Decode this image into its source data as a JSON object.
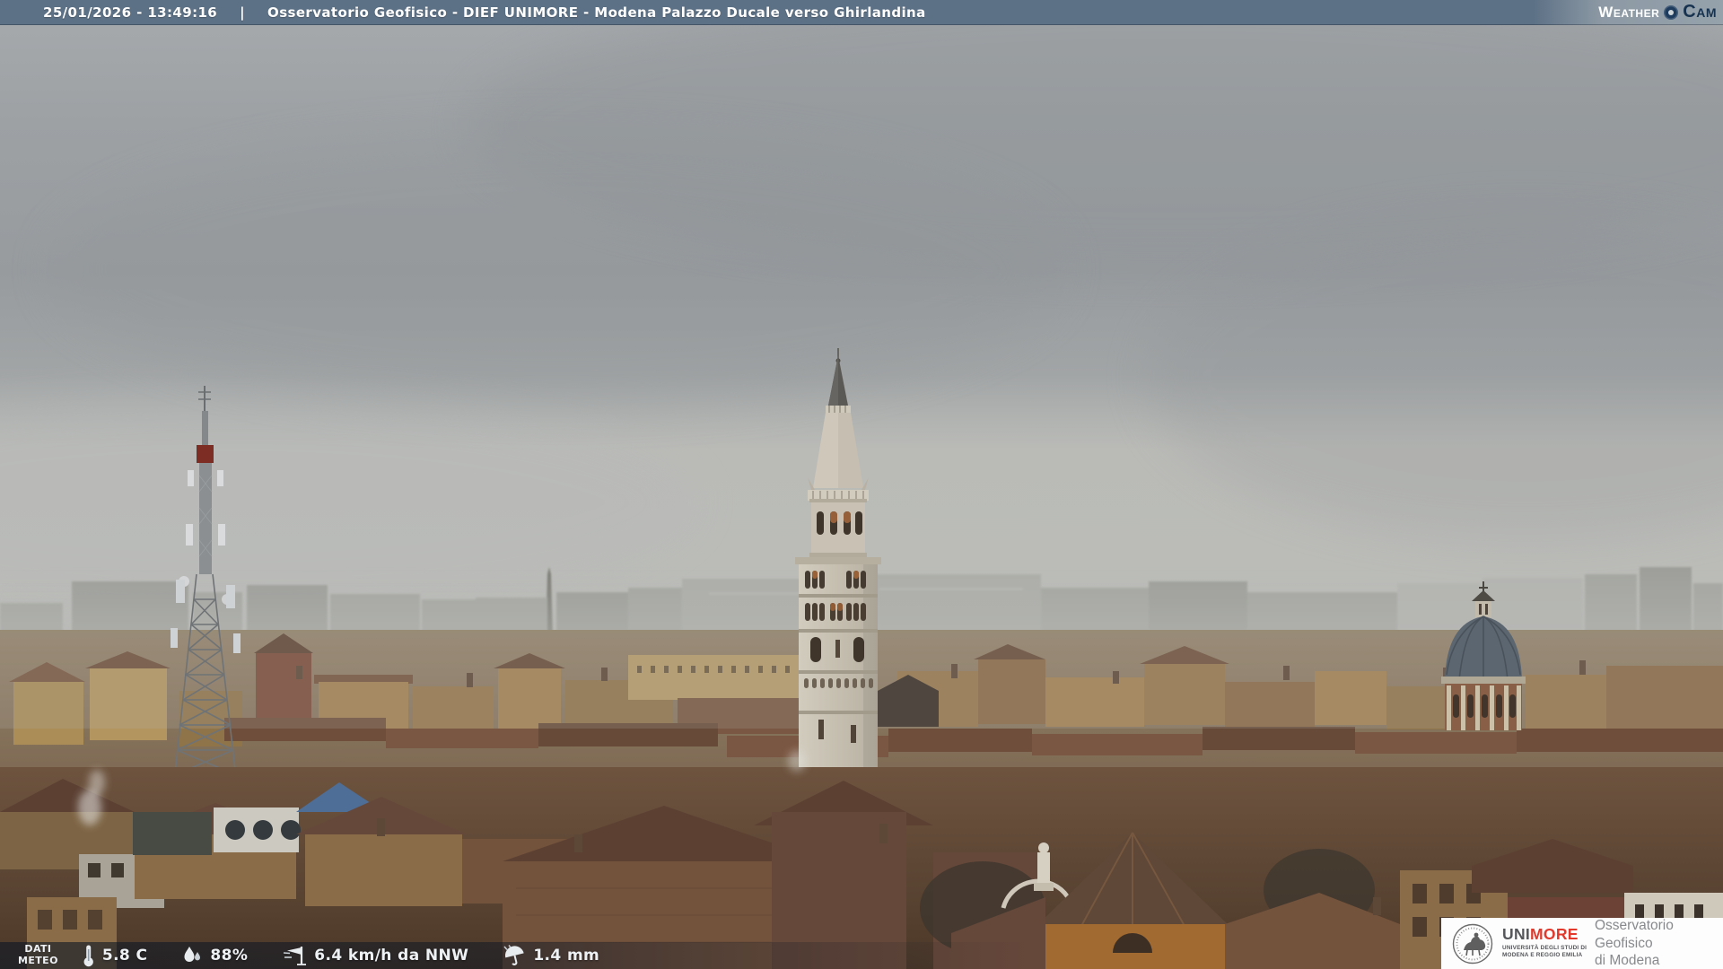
{
  "header": {
    "datetime": "25/01/2026 - 13:49:16",
    "separator": "|",
    "title": "Osservatorio Geofisico - DIEF UNIMORE - Modena Palazzo Ducale verso Ghirlandina",
    "watermark": {
      "word1": "Weather",
      "word2": "Cam"
    }
  },
  "meteo": {
    "label": {
      "line1": "DATI",
      "line2": "METEO"
    },
    "temperature": "5.8 C",
    "humidity": "88%",
    "wind": "6.4 km/h da NNW",
    "rain": "1.4 mm"
  },
  "branding": {
    "acronym_gray": "UNI",
    "acronym_red": "MORE",
    "university": {
      "line1": "UNIVERSITÀ DEGLI STUDI DI",
      "line2": "MODENA E REGGIO EMILIA"
    },
    "observatory": {
      "line1": "Osservatorio Geofisico",
      "line2": "di Modena"
    }
  },
  "colors": {
    "header_bar": "#5d7186",
    "header_bar_right": "#95a1ab",
    "watermark_navy": "#16324f",
    "unimore_red": "#e2392c",
    "meteo_bar_overlay": "rgba(12,22,36,0.6)",
    "sky": "#9da1a4",
    "horizon_haze": "#b6b8b5",
    "rooftops": "#7a5843",
    "tower_stone": "#c9c2b4",
    "dome_blue": "#5c6670"
  }
}
